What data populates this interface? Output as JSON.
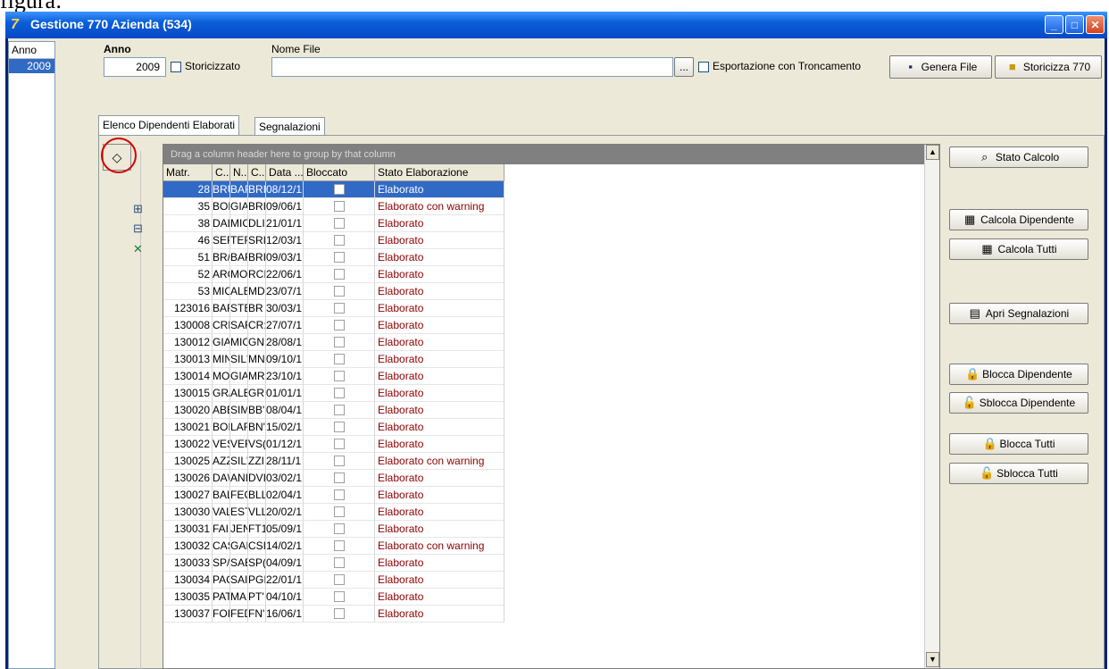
{
  "caption": "figura:",
  "window": {
    "title": "Gestione 770 Azienda (534)"
  },
  "year_list": {
    "header": "Anno",
    "selected": "2009"
  },
  "toolbar": {
    "anno_label": "Anno",
    "anno_value": "2009",
    "storicizzato_label": "Storicizzato",
    "nome_file_label": "Nome File",
    "nome_file_value": "",
    "browse_label": "...",
    "troncamento_label": "Esportazione con Troncamento",
    "genera_file_label": "Genera File",
    "storicizza_label": "Storicizza 770"
  },
  "tabs": [
    {
      "label": "Elenco Dipendenti Elaborati"
    },
    {
      "label": "Segnalazioni"
    }
  ],
  "grid": {
    "group_panel_text": "Drag a column header here to group by that column",
    "columns": [
      "Matr.",
      "C...",
      "N...",
      "C...",
      "Data ...",
      "Bloccato",
      "Stato Elaborazione"
    ],
    "rows": [
      {
        "matr": "28",
        "c1": "BRU",
        "n": "BAF",
        "c2": "BRI",
        "data": "08/12/1",
        "stato": "Elaborato"
      },
      {
        "matr": "35",
        "c1": "BOF",
        "n": "GIA",
        "c2": "BRI",
        "data": "09/06/1",
        "stato": "Elaborato con warning"
      },
      {
        "matr": "38",
        "c1": "DAL",
        "n": "MIC",
        "c2": "DLI",
        "data": "21/01/1",
        "stato": "Elaborato"
      },
      {
        "matr": "46",
        "c1": "SEF",
        "n": "TEF",
        "c2": "SRI",
        "data": "12/03/1",
        "stato": "Elaborato"
      },
      {
        "matr": "51",
        "c1": "BR/",
        "n": "BAF",
        "c2": "BRI",
        "data": "09/03/1",
        "stato": "Elaborato"
      },
      {
        "matr": "52",
        "c1": "ARC",
        "n": "MO",
        "c2": "RCI",
        "data": "22/06/1",
        "stato": "Elaborato"
      },
      {
        "matr": "53",
        "c1": "MIC",
        "n": "ALE",
        "c2": "MD",
        "data": "23/07/1",
        "stato": "Elaborato"
      },
      {
        "matr": "123016",
        "c1": "BAF",
        "n": "STE",
        "c2": "BR",
        "data": "30/03/1",
        "stato": "Elaborato"
      },
      {
        "matr": "130008",
        "c1": "CRE",
        "n": "SAF",
        "c2": "CR:",
        "data": "27/07/1",
        "stato": "Elaborato"
      },
      {
        "matr": "130012",
        "c1": "GIA",
        "n": "MIC",
        "c2": "GN",
        "data": "28/08/1",
        "stato": "Elaborato"
      },
      {
        "matr": "130013",
        "c1": "MIN",
        "n": "SIL'",
        "c2": "MN",
        "data": "09/10/1",
        "stato": "Elaborato"
      },
      {
        "matr": "130014",
        "c1": "MO",
        "n": "GIA",
        "c2": "MR",
        "data": "23/10/1",
        "stato": "Elaborato"
      },
      {
        "matr": "130015",
        "c1": "GR/",
        "n": "ALE",
        "c2": "GR.",
        "data": "01/01/1",
        "stato": "Elaborato"
      },
      {
        "matr": "130020",
        "c1": "ABE",
        "n": "SIM",
        "c2": "BB'",
        "data": "08/04/1",
        "stato": "Elaborato"
      },
      {
        "matr": "130021",
        "c1": "BOI",
        "n": "LAF",
        "c2": "BN'",
        "data": "15/02/1",
        "stato": "Elaborato"
      },
      {
        "matr": "130022",
        "c1": "VES",
        "n": "VEF",
        "c2": "VS(",
        "data": "01/12/1",
        "stato": "Elaborato"
      },
      {
        "matr": "130025",
        "c1": "AZZ",
        "n": "SIL'",
        "c2": "ZZI",
        "data": "28/11/1",
        "stato": "Elaborato con warning"
      },
      {
        "matr": "130026",
        "c1": "DA\\",
        "n": "ANI",
        "c2": "DVI",
        "data": "03/02/1",
        "stato": "Elaborato"
      },
      {
        "matr": "130027",
        "c1": "BAL",
        "n": "FEC",
        "c2": "BLL",
        "data": "02/04/1",
        "stato": "Elaborato"
      },
      {
        "matr": "130030",
        "c1": "VAL",
        "n": "EST",
        "c2": "VLL",
        "data": "20/02/1",
        "stato": "Elaborato"
      },
      {
        "matr": "130031",
        "c1": "FAII",
        "n": "JEN",
        "c2": "FT1",
        "data": "05/09/1",
        "stato": "Elaborato"
      },
      {
        "matr": "130032",
        "c1": "CAS",
        "n": "GAI",
        "c2": "CSI",
        "data": "14/02/1",
        "stato": "Elaborato con warning"
      },
      {
        "matr": "130033",
        "c1": "SP/",
        "n": "SAE",
        "c2": "SP(",
        "data": "04/09/1",
        "stato": "Elaborato"
      },
      {
        "matr": "130034",
        "c1": "PAC",
        "n": "SAI",
        "c2": "PGI",
        "data": "22/01/1",
        "stato": "Elaborato"
      },
      {
        "matr": "130035",
        "c1": "PAT",
        "n": "MA",
        "c2": "PT'",
        "data": "04/10/1",
        "stato": "Elaborato"
      },
      {
        "matr": "130037",
        "c1": "FOI",
        "n": "FED",
        "c2": "FN'",
        "data": "16/06/1",
        "stato": "Elaborato"
      }
    ]
  },
  "side_buttons": {
    "stato_calcolo": "Stato Calcolo",
    "calcola_dipendente": "Calcola Dipendente",
    "calcola_tutti": "Calcola Tutti",
    "apri_segnalazioni": "Apri Segnalazioni",
    "blocca_dipendente": "Blocca Dipendente",
    "sblocca_dipendente": "Sblocca Dipendente",
    "blocca_tutti": "Blocca Tutti",
    "sblocca_tutti": "Sblocca Tutti"
  },
  "colors": {
    "title_bar": "#0a5fd8",
    "selection": "#316ac5",
    "warning_text": "#8b0000"
  }
}
